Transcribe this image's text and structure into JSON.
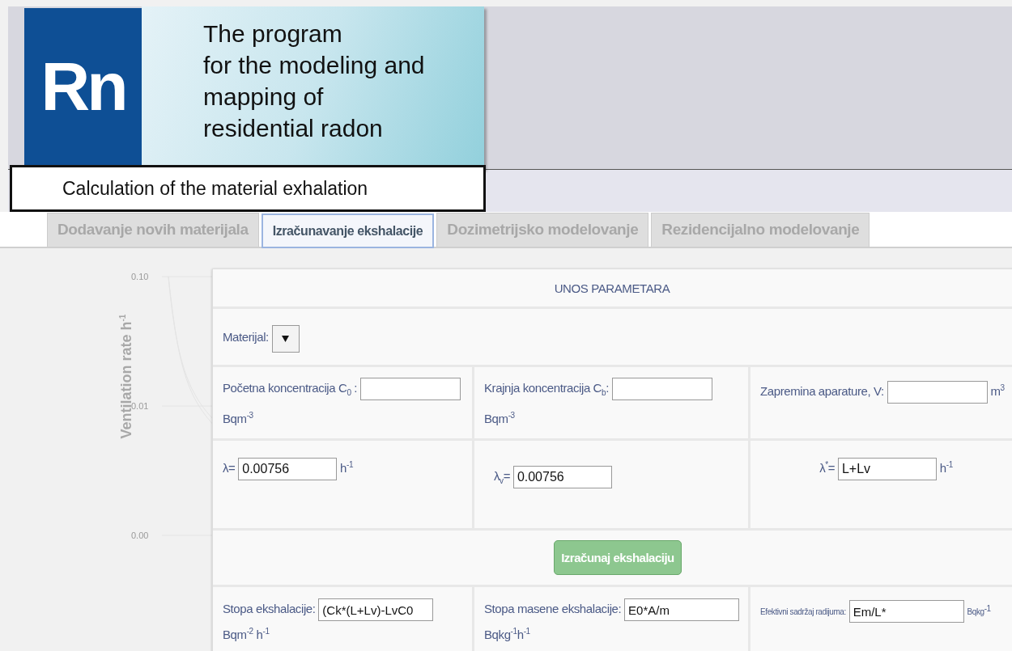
{
  "logo": {
    "text": "Rn"
  },
  "banner": {
    "lines": [
      "The program",
      "for the modeling and",
      "mapping of",
      "residential radon"
    ]
  },
  "caption": {
    "text": "Calculation of the material exhalation"
  },
  "tabs": [
    {
      "label": "Dodavanje novih materijala",
      "selected": false
    },
    {
      "label": "Izračunavanje ekshalacije",
      "selected": true
    },
    {
      "label": "Dozimetrijsko modelovanje",
      "selected": false
    },
    {
      "label": "Rezidencijalno modelovanje",
      "selected": false
    }
  ],
  "backdrop_chart": {
    "ylabel": "Ventilation rate h$^{-1}$",
    "yticks": [
      "0.10",
      "0.01",
      "0.00"
    ]
  },
  "form": {
    "title": "UNOS PARAMETARA",
    "material": {
      "label": "Materijal:"
    },
    "rows": [
      [
        {
          "label": "Početna koncentracija C$_{0}$ :",
          "unit": "Bqm$^{-3}$"
        },
        {
          "label": "Krajnja koncentracija C$_{b}$:",
          "unit": "Bqm$^{-3}$"
        },
        {
          "label": "Zapremina aparature, V:",
          "unit": "m$^{3}$"
        }
      ],
      [
        {
          "label": "λ=",
          "value": "0.00756",
          "unit": "h$^{-1}$"
        },
        {
          "label": "λ$_{v}$=",
          "value": "0.00756"
        },
        {
          "label": "λ$^{*}$=",
          "value": "L+Lv",
          "unit": "h$^{-1}$"
        }
      ]
    ],
    "button": "Izračunaj ekshalaciju",
    "results": [
      {
        "label": "Stopa ekshalacije:",
        "value": "(Ck*(L+Lv)-LvC0",
        "unit": "Bqm$^{-2}$ h$^{-1}$",
        "compact": false
      },
      {
        "label": "Stopa masene ekshalacije:",
        "value": "E0*A/m",
        "unit": "Bqkg$^{-1}$h$^{-1}$",
        "compact": false
      },
      {
        "label": "Efektivni sadržaj radijuma:",
        "value": "Em/L*",
        "unit": "Bqkg$^{-1}$",
        "compact": true
      }
    ]
  }
}
